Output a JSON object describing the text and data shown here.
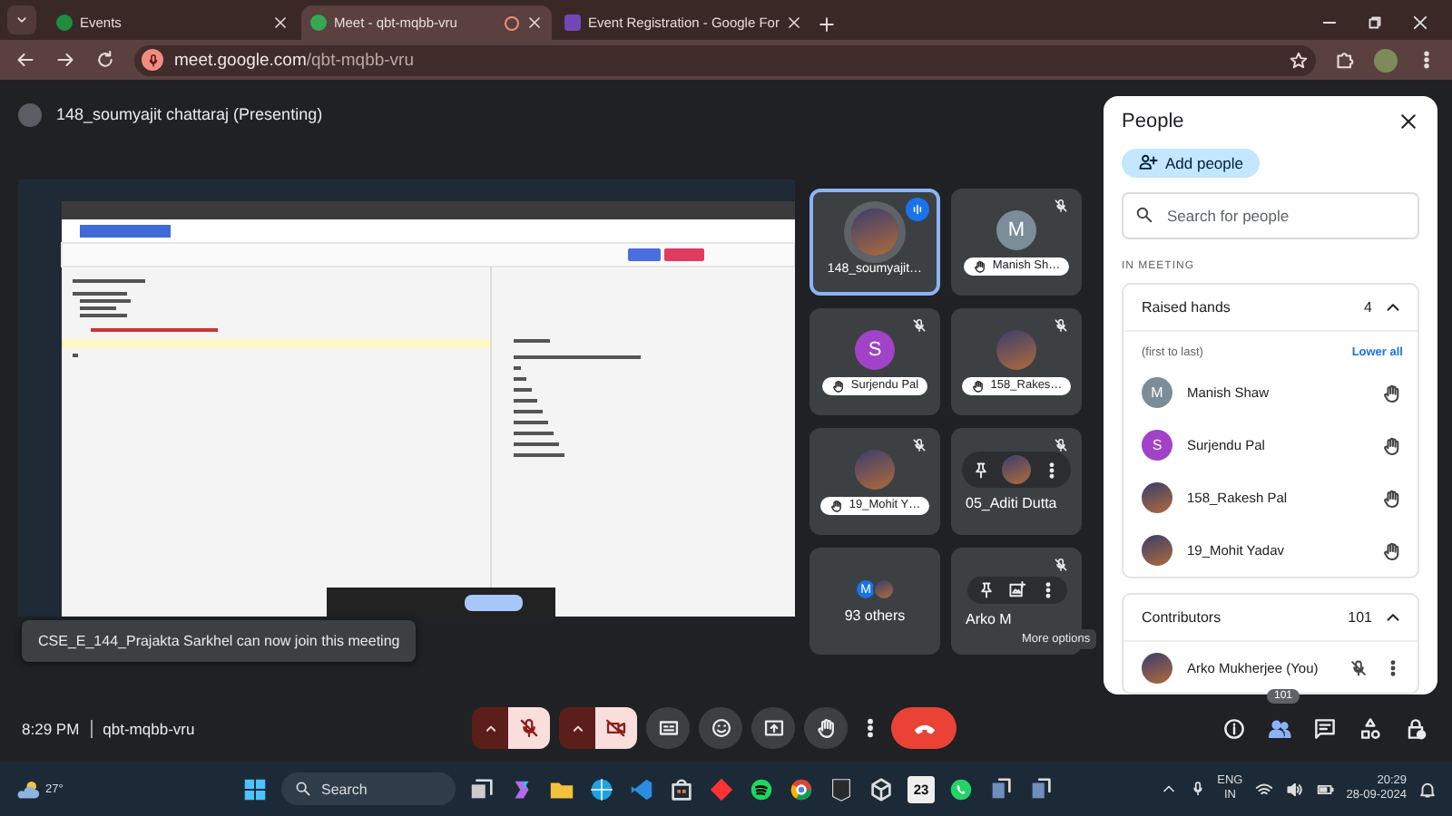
{
  "browser": {
    "tabs": [
      {
        "kind": "events",
        "title": "Events",
        "selected": false,
        "recording": false
      },
      {
        "kind": "meet",
        "title": "Meet - qbt-mqbb-vru",
        "selected": true,
        "recording": true
      },
      {
        "kind": "forms",
        "title": "Event Registration - Google For",
        "selected": false,
        "recording": false
      }
    ],
    "url_host": "meet.google.com",
    "url_path": "/qbt-mqbb-vru"
  },
  "meeting": {
    "presenter": "148_soumyajit chattaraj (Presenting)",
    "time": "8:29 PM",
    "code": "qbt-mqbb-vru"
  },
  "tiles": [
    {
      "kind": "person",
      "name": "148_soumyajit…",
      "photo": true,
      "speaking": true,
      "muted": false,
      "hand_raised": false,
      "hovered": false
    },
    {
      "kind": "person",
      "name": "Manish Sh…",
      "photo": false,
      "letter": "M",
      "color": "#7b8d99",
      "speaking": false,
      "muted": true,
      "hand_raised": true,
      "hovered": false
    },
    {
      "kind": "person",
      "name": "Surjendu Pal",
      "photo": false,
      "letter": "S",
      "color": "#a142c7",
      "speaking": false,
      "muted": true,
      "hand_raised": true,
      "hovered": false
    },
    {
      "kind": "person",
      "name": "158_Rakes…",
      "photo": true,
      "speaking": false,
      "muted": true,
      "hand_raised": true,
      "hovered": false
    },
    {
      "kind": "person",
      "name": "19_Mohit Y…",
      "photo": true,
      "speaking": false,
      "muted": true,
      "hand_raised": true,
      "hovered": false
    },
    {
      "kind": "person",
      "name": "05_Aditi Dutta",
      "photo": true,
      "speaking": false,
      "muted": true,
      "hand_raised": false,
      "hovered": true
    },
    {
      "kind": "others",
      "name": "93 others",
      "letter": "M",
      "color": "#1a73e8"
    },
    {
      "kind": "person",
      "name": "Arko M",
      "photo": false,
      "speaking": false,
      "muted": true,
      "hand_raised": false,
      "hovered": true
    }
  ],
  "tooltip": "More options",
  "toast": "CSE_E_144_Prajakta Sarkhel can now join this meeting",
  "people_panel": {
    "title": "People",
    "add_button": "Add people",
    "search": {
      "placeholder": "Search for people"
    },
    "section": "IN MEETING",
    "raised_hands": {
      "title": "Raised hands",
      "count": "4",
      "expanded": true,
      "order_note": "(first to last)",
      "action": "Lower all",
      "people": [
        {
          "name": "Manish Shaw",
          "letter": "M",
          "color": "#7b8d99"
        },
        {
          "name": "Surjendu Pal",
          "letter": "S",
          "color": "#a142c7"
        },
        {
          "name": "158_Rakesh Pal"
        },
        {
          "name": "19_Mohit Yadav"
        }
      ]
    },
    "contributors": {
      "title": "Contributors",
      "count": "101",
      "expanded": true,
      "people": [
        {
          "name": "Arko Mukherjee (You)",
          "muted": true
        }
      ]
    }
  },
  "controls": [
    {
      "kind": "mic",
      "on": false
    },
    {
      "kind": "camera",
      "on": false
    },
    {
      "kind": "captions"
    },
    {
      "kind": "reactions"
    },
    {
      "kind": "present"
    },
    {
      "kind": "hand"
    },
    {
      "kind": "more"
    },
    {
      "kind": "leave"
    }
  ],
  "side_controls": [
    {
      "kind": "info",
      "selected": false
    },
    {
      "kind": "people",
      "selected": true,
      "badge": "101"
    },
    {
      "kind": "chat",
      "selected": false
    },
    {
      "kind": "activities",
      "selected": false
    },
    {
      "kind": "host",
      "selected": false
    }
  ],
  "taskbar": {
    "weather": "27°",
    "search": "Search",
    "calendar_app": "23",
    "lang": "ENG",
    "region": "IN",
    "time": "20:29",
    "date": "28-09-2024"
  }
}
